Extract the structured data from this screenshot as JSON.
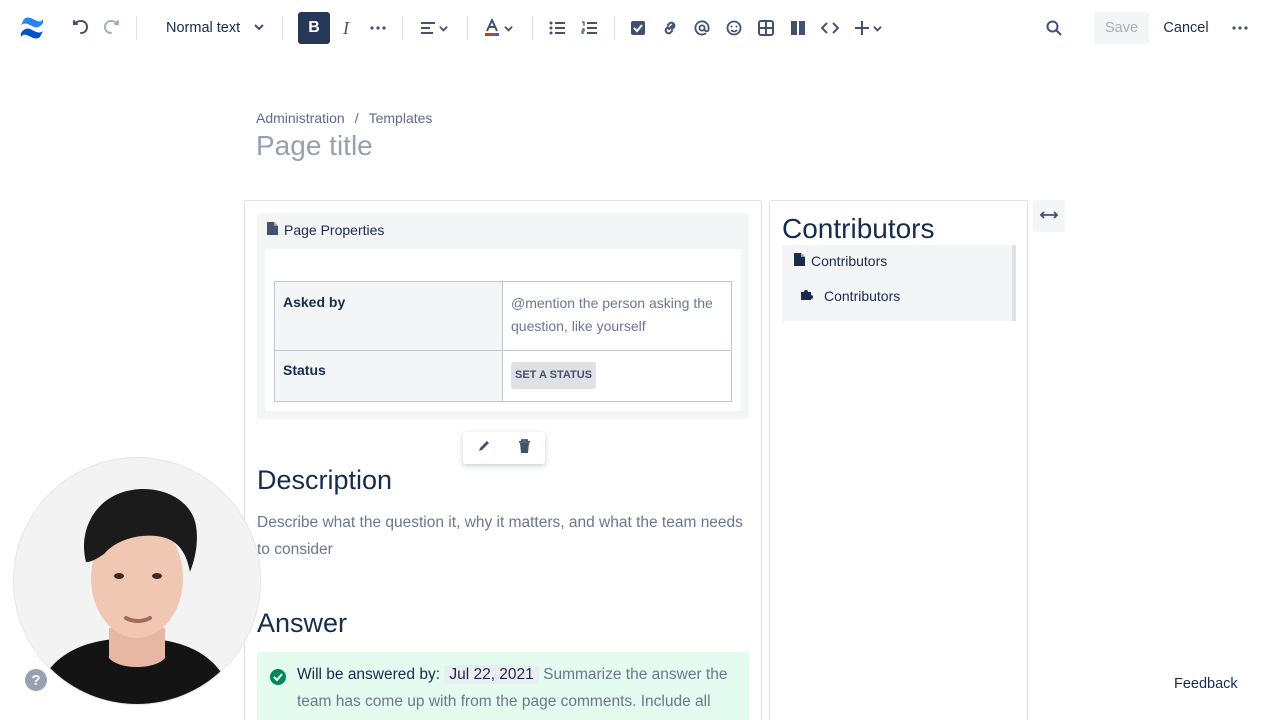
{
  "toolbar": {
    "text_style": "Normal text",
    "save_label": "Save",
    "cancel_label": "Cancel",
    "colors": {
      "bold_active_bg": "#253858",
      "brand": "#0052cc"
    }
  },
  "breadcrumb": {
    "items": [
      "Administration",
      "Templates"
    ],
    "separator": "/"
  },
  "page_title_placeholder": "Page title",
  "page_properties": {
    "header": "Page Properties",
    "rows": [
      {
        "key": "Asked by",
        "value": "@mention the person asking the question, like yourself"
      },
      {
        "key": "Status",
        "value": "SET A STATUS"
      }
    ]
  },
  "description": {
    "heading": "Description",
    "text": "Describe what the question it, why it matters, and what the team needs to consider"
  },
  "answer": {
    "heading": "Answer",
    "label": "Will be answered by:",
    "date": "Jul 22, 2021",
    "text": "Summarize the answer the team has come up with from the page comments. Include all"
  },
  "contributors": {
    "heading": "Contributors",
    "macro_header": "Contributors",
    "item": "Contributors"
  },
  "help_label": "?",
  "feedback_label": "Feedback"
}
